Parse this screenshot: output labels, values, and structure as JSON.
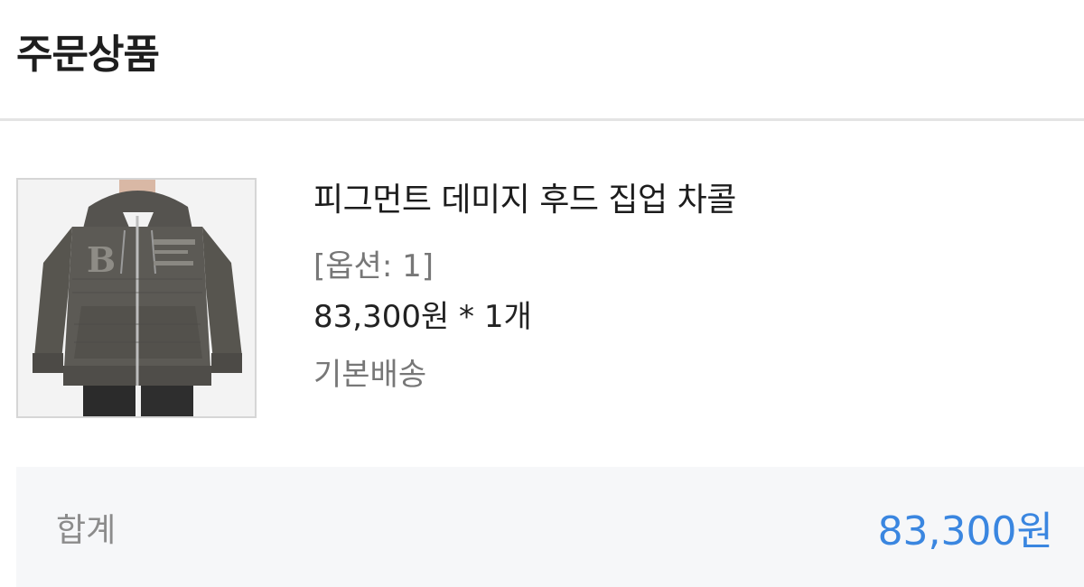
{
  "section": {
    "title": "주문상품"
  },
  "product": {
    "image_alt": "피그먼트 데미지 후드 집업 차콜",
    "name": "피그먼트 데미지 후드 집업 차콜",
    "option": "[옵션: 1]",
    "price_line": "83,300원 * 1개",
    "shipping": "기본배송"
  },
  "summary": {
    "total_label": "합계",
    "total_amount": "83,300원"
  },
  "colors": {
    "accent": "#3a86e0",
    "muted_text": "#777777",
    "divider": "#e4e4e4",
    "summary_background": "#f6f7f9"
  }
}
